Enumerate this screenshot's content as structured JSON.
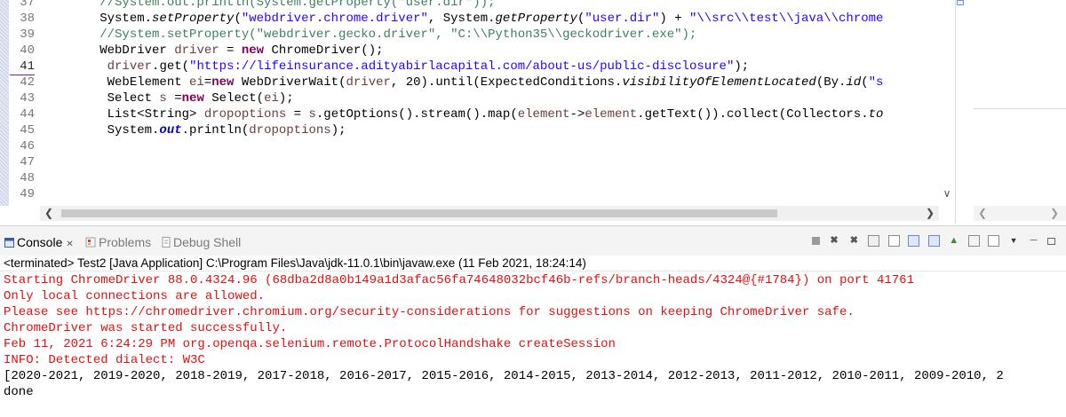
{
  "editor": {
    "line_numbers": [
      "37",
      "38",
      "39",
      "40",
      "41",
      "42",
      "43",
      "44",
      "45",
      "46",
      "47",
      "48",
      "49"
    ],
    "code_lines": [
      [
        {
          "t": "        //System.out.println(System.getProperty(\"user.dir\"));",
          "c": "cm"
        }
      ],
      [
        {
          "t": "        System.",
          "c": ""
        },
        {
          "t": "setProperty",
          "c": "it"
        },
        {
          "t": "(",
          "c": ""
        },
        {
          "t": "\"webdriver.chrome.driver\"",
          "c": "st"
        },
        {
          "t": ", System.",
          "c": ""
        },
        {
          "t": "getProperty",
          "c": "it"
        },
        {
          "t": "(",
          "c": ""
        },
        {
          "t": "\"user.dir\"",
          "c": "st"
        },
        {
          "t": ") + ",
          "c": ""
        },
        {
          "t": "\"\\\\src\\\\test\\\\java\\\\chrome",
          "c": "st"
        }
      ],
      [
        {
          "t": "        //System.setProperty(\"webdriver.gecko.driver\", \"C:\\\\Python35\\\\geckodriver.exe\");",
          "c": "cm"
        }
      ],
      [
        {
          "t": "        WebDriver ",
          "c": ""
        },
        {
          "t": "driver",
          "c": "vr"
        },
        {
          "t": " = ",
          "c": ""
        },
        {
          "t": "new",
          "c": "kw"
        },
        {
          "t": " ChromeDriver();",
          "c": ""
        }
      ],
      [
        {
          "t": "         ",
          "c": ""
        },
        {
          "t": "driver",
          "c": "vr"
        },
        {
          "t": ".get(",
          "c": ""
        },
        {
          "t": "\"https://lifeinsurance.adityabirlacapital.com/about-us/public-disclosure\"",
          "c": "st"
        },
        {
          "t": ");",
          "c": ""
        }
      ],
      [
        {
          "t": "         WebElement ",
          "c": ""
        },
        {
          "t": "ei",
          "c": "vr"
        },
        {
          "t": "=",
          "c": ""
        },
        {
          "t": "new",
          "c": "kw"
        },
        {
          "t": " WebDriverWait(",
          "c": ""
        },
        {
          "t": "driver",
          "c": "vr"
        },
        {
          "t": ", 20).until(ExpectedConditions.",
          "c": ""
        },
        {
          "t": "visibilityOfElementLocated",
          "c": "it"
        },
        {
          "t": "(By.",
          "c": ""
        },
        {
          "t": "id",
          "c": "it"
        },
        {
          "t": "(",
          "c": ""
        },
        {
          "t": "\"s",
          "c": "st"
        }
      ],
      [
        {
          "t": "         Select ",
          "c": ""
        },
        {
          "t": "s",
          "c": "vr"
        },
        {
          "t": " =",
          "c": ""
        },
        {
          "t": "new",
          "c": "kw"
        },
        {
          "t": " Select(",
          "c": ""
        },
        {
          "t": "ei",
          "c": "vr"
        },
        {
          "t": ");",
          "c": ""
        }
      ],
      [
        {
          "t": "         List<String> ",
          "c": ""
        },
        {
          "t": "dropoptions",
          "c": "vr"
        },
        {
          "t": " = ",
          "c": ""
        },
        {
          "t": "s",
          "c": "vr"
        },
        {
          "t": ".getOptions().stream().map(",
          "c": ""
        },
        {
          "t": "element",
          "c": "vr"
        },
        {
          "t": "->",
          "c": ""
        },
        {
          "t": "element",
          "c": "vr"
        },
        {
          "t": ".getText()).collect(Collectors.",
          "c": ""
        },
        {
          "t": "to",
          "c": "it"
        }
      ],
      [
        {
          "t": "         System.",
          "c": ""
        },
        {
          "t": "out",
          "c": "sf"
        },
        {
          "t": ".println(",
          "c": ""
        },
        {
          "t": "dropoptions",
          "c": "vr"
        },
        {
          "t": ");",
          "c": ""
        }
      ],
      [],
      [],
      [],
      []
    ],
    "current_line": "41"
  },
  "console": {
    "tabs": [
      {
        "label": "Console",
        "icon": "console-icon",
        "active": true
      },
      {
        "label": "Problems",
        "icon": "problems-icon",
        "active": false
      },
      {
        "label": "Debug Shell",
        "icon": "debug-shell-icon",
        "active": false
      }
    ],
    "close_glyph": "✕",
    "status": "<terminated> Test2 [Java Application] C:\\Program Files\\Java\\jdk-11.0.1\\bin\\javaw.exe (11 Feb 2021, 18:24:14)",
    "output_lines": [
      {
        "text": "Starting ChromeDriver 88.0.4324.96 (68dba2d8a0b149a1d3afac56fa74648032bcf46b-refs/branch-heads/4324@{#1784}) on port 41761",
        "stream": "err"
      },
      {
        "text": "Only local connections are allowed.",
        "stream": "err"
      },
      {
        "text": "Please see https://chromedriver.chromium.org/security-considerations for suggestions on keeping ChromeDriver safe.",
        "stream": "err"
      },
      {
        "text": "ChromeDriver was started successfully.",
        "stream": "err"
      },
      {
        "text": "Feb 11, 2021 6:24:29 PM org.openqa.selenium.remote.ProtocolHandshake createSession",
        "stream": "err"
      },
      {
        "text": "INFO: Detected dialect: W3C",
        "stream": "err"
      },
      {
        "text": "[2020-2021, 2019-2020, 2018-2019, 2017-2018, 2016-2017, 2015-2016, 2014-2015, 2013-2014, 2012-2013, 2011-2012, 2010-2011, 2009-2010, 2",
        "stream": "std"
      },
      {
        "text": "done",
        "stream": "std"
      }
    ],
    "toolbar_icons": [
      "stop-icon",
      "remove-launch-icon",
      "remove-all-icon",
      "scroll-lock-icon",
      "word-wrap-icon",
      "show-on-output-icon",
      "show-on-error-icon",
      "pin-console-icon",
      "display-console-icon",
      "open-console-icon",
      "view-menu-icon",
      "minimize-icon",
      "maximize-icon"
    ]
  },
  "colors": {
    "stderr": "#e01010",
    "stdout": "#000000",
    "comment": "#3f7f5f",
    "keyword": "#7f0055",
    "string": "#2a00ff",
    "local_variable": "#6a3e3e"
  }
}
